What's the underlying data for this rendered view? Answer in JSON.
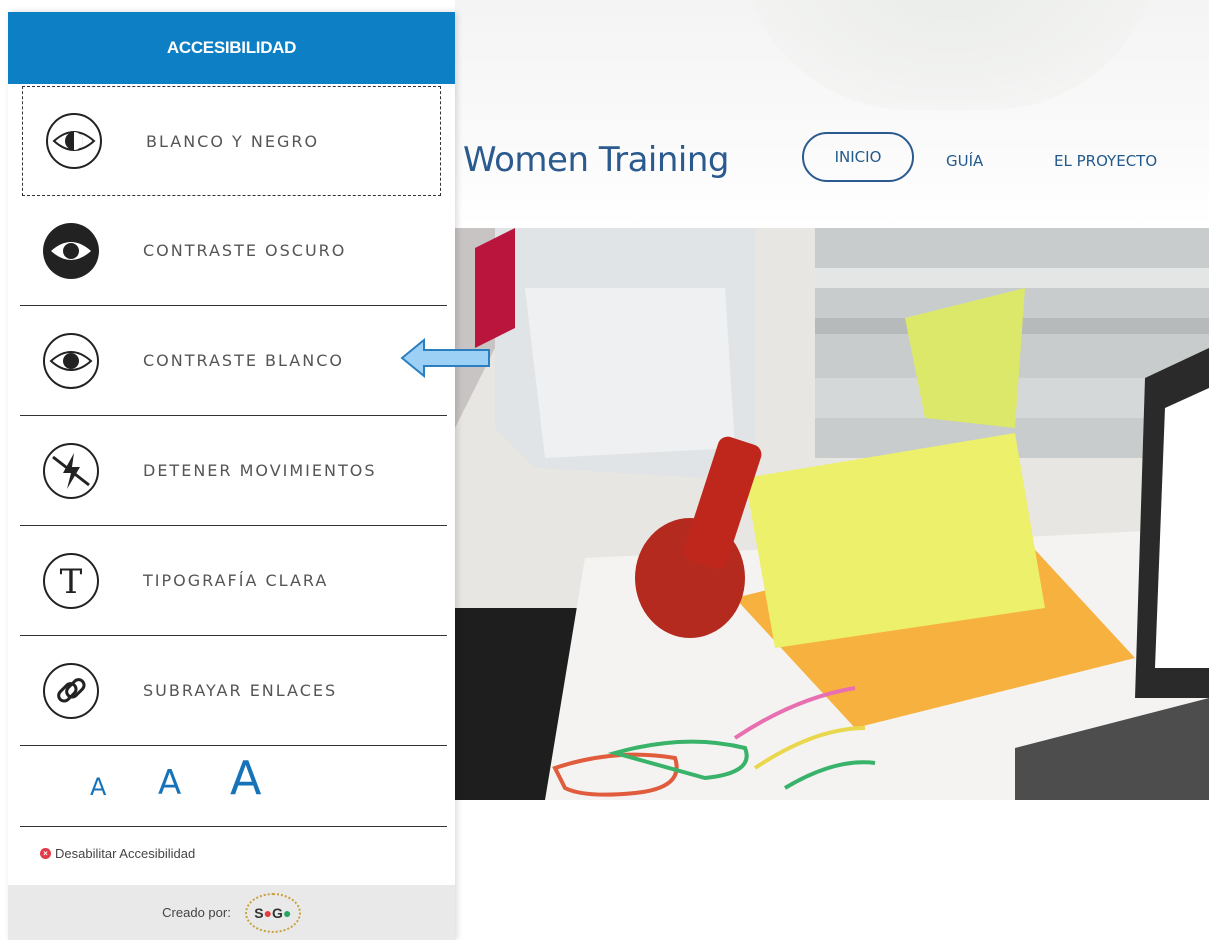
{
  "panel": {
    "title": "ACCESIBILIDAD",
    "options": [
      {
        "label": "BLANCO Y NEGRO",
        "icon": "eye-grayscale-icon"
      },
      {
        "label": "CONTRASTE OSCURO",
        "icon": "eye-dark-icon"
      },
      {
        "label": "CONTRASTE BLANCO",
        "icon": "eye-light-icon"
      },
      {
        "label": "DETENER MOVIMIENTOS",
        "icon": "stop-motion-icon"
      },
      {
        "label": "TIPOGRAFÍA CLARA",
        "icon": "typography-icon"
      },
      {
        "label": "SUBRAYAR ENLACES",
        "icon": "link-icon"
      }
    ],
    "font_sizes": [
      "A",
      "A",
      "A"
    ],
    "disable_label": "Desabilitar Accesibilidad",
    "footer": {
      "created_by": "Creado por:",
      "logo_text": [
        "S",
        "●",
        "G",
        "●"
      ]
    }
  },
  "site": {
    "brand": "Women Training",
    "nav": [
      "INICIO",
      "GUÍA",
      "EL PROYECTO"
    ]
  },
  "colors": {
    "accent": "#0d7fc4",
    "brand": "#2b5a8f",
    "arrow": "#9dd0f5"
  }
}
